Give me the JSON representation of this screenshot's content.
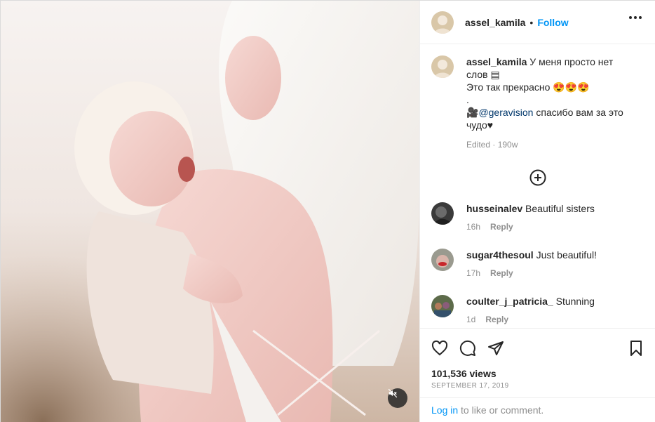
{
  "post": {
    "username": "assel_kamila",
    "follow_label": "Follow",
    "separator": "•",
    "caption_line1": "У меня просто нет слов",
    "caption_line2": "Это так прекрасно 😍😍😍",
    "caption_line3": ".",
    "caption_line4_prefix": "🎥",
    "caption_mention": "@geravision",
    "caption_line4_suffix": " спасибо вам за это чудо♥",
    "caption_meta": "Edited · 190w"
  },
  "comments": [
    {
      "user": "husseinalev",
      "text": "Beautiful sisters",
      "time": "16h",
      "reply": "Reply"
    },
    {
      "user": "sugar4thesoul",
      "text": "Just beautiful!",
      "time": "17h",
      "reply": "Reply"
    },
    {
      "user": "coulter_j_patricia_",
      "text": "Stunning",
      "time": "1d",
      "reply": "Reply"
    }
  ],
  "footer": {
    "views": "101,536 views",
    "date": "SEPTEMBER 17, 2019",
    "login_link": "Log in",
    "login_suffix": " to like or comment."
  },
  "icons": {
    "like": "heart-icon",
    "comment": "comment-icon",
    "share": "paper-plane-icon",
    "save": "bookmark-icon",
    "more": "more-options-icon",
    "add": "add-comment-icon",
    "mute": "muted-speaker-icon"
  },
  "colors": {
    "accent": "#0095f6",
    "text": "#262626",
    "muted": "#8e8e8e",
    "mention": "#00376b"
  }
}
